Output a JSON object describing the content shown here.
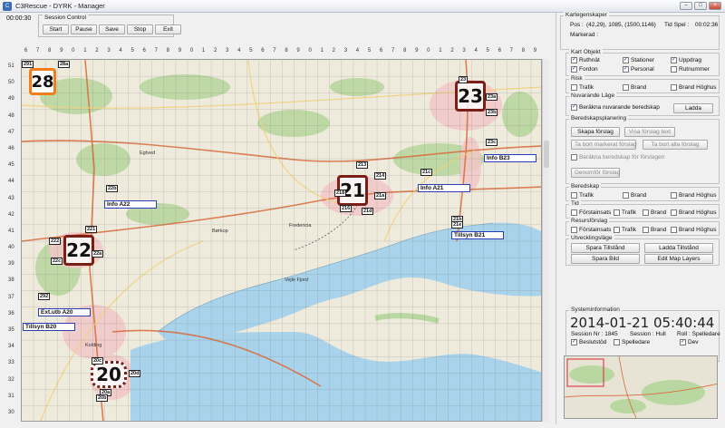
{
  "window": {
    "title": "C3Rescue - DYRK - Manager",
    "icon_name": "app-icon",
    "buttons": [
      "minimize-icon",
      "maximize-icon",
      "close-icon"
    ]
  },
  "clock": "00:00:30",
  "session_control": {
    "legend": "Session Control",
    "buttons": [
      "Start",
      "Pause",
      "Save",
      "Stop",
      "Exit"
    ]
  },
  "grid": {
    "columns": [
      "6",
      "7",
      "8",
      "9",
      "0",
      "1",
      "2",
      "3",
      "4",
      "5",
      "6",
      "7",
      "8",
      "9",
      "0",
      "1",
      "2",
      "3",
      "4",
      "5",
      "6",
      "7",
      "8",
      "9",
      "0",
      "1",
      "2",
      "3",
      "4",
      "5",
      "6",
      "7",
      "8",
      "9",
      "0",
      "1",
      "2",
      "3",
      "4",
      "5",
      "6",
      "7",
      "8",
      "9"
    ],
    "rows": [
      "51",
      "50",
      "49",
      "48",
      "47",
      "46",
      "45",
      "44",
      "43",
      "42",
      "41",
      "40",
      "39",
      "38",
      "37",
      "36",
      "35",
      "34",
      "33",
      "32",
      "31",
      "30"
    ]
  },
  "map": {
    "units": [
      {
        "label": "28",
        "style": "orange"
      },
      {
        "label": "23",
        "style": "dark"
      },
      {
        "label": "21",
        "style": "dark"
      },
      {
        "label": "22",
        "style": "dark"
      },
      {
        "label": "20",
        "style": "dotted"
      }
    ],
    "tags": [
      "291",
      "28a",
      "23",
      "23a",
      "23b",
      "23c",
      "21c",
      "213",
      "214",
      "21a",
      "21b",
      "21e",
      "218",
      "216",
      "21d",
      "22b",
      "22a",
      "22c",
      "221",
      "222",
      "292",
      "20c",
      "20a",
      "20b",
      "20d"
    ],
    "info_boxes": [
      "Info A22",
      "Info B23",
      "Info A21",
      "Tillsyn B21",
      "Ext.utb A20",
      "Tillsyn B20"
    ],
    "places": [
      "Vejle Fjord",
      "Kolding",
      "Fredericia",
      "Børkop",
      "Egtved"
    ]
  },
  "panel": {
    "kartegenskaper": {
      "legend": "Kartegenskaper",
      "pos_label": "Pos :",
      "pos_value": "(42,29), 1085, (1500,1146)",
      "tid_spel_label": "Tid Spel :",
      "tid_spel_value": "00:02:36",
      "markerad_label": "Markerad :"
    },
    "kart_objekt": {
      "legend": "Kart Objekt",
      "items": [
        {
          "label": "Ruthnät",
          "checked": true
        },
        {
          "label": "Stationer",
          "checked": true
        },
        {
          "label": "Uppdrag",
          "checked": true
        },
        {
          "label": "Fordon",
          "checked": true
        },
        {
          "label": "Personal",
          "checked": true
        },
        {
          "label": "Rutnummer",
          "checked": false
        }
      ]
    },
    "risk": {
      "legend": "Risk",
      "items": [
        {
          "label": "Trafik"
        },
        {
          "label": "Brand"
        },
        {
          "label": "Brand Höghus"
        }
      ]
    },
    "nuvarande": {
      "legend": "Nuvarande Läge",
      "checkbox_label": "Beräkna nuvarande beredskap",
      "button": "Ladda"
    },
    "beredskapsplanering": {
      "legend": "Beredskapsplanering",
      "skapa": "Skapa förslag",
      "visa": "Visa förslag text",
      "ta_bort_markerat": "Ta bort markerat förslag",
      "ta_bort_alla": "Ta bort alla förslag",
      "berakna_label": "Beräkna beredskap för förslagen",
      "genomfor": "Genomför förslag"
    },
    "beredskap": {
      "legend": "Beredskap",
      "items": [
        {
          "label": "Trafik"
        },
        {
          "label": "Brand"
        },
        {
          "label": "Brand Höghus"
        }
      ]
    },
    "tid": {
      "legend": "Tid",
      "items": [
        {
          "label": "Förstainsats"
        },
        {
          "label": "Trafik"
        },
        {
          "label": "Brand"
        },
        {
          "label": "Brand Höghus"
        }
      ]
    },
    "resursforslag": {
      "legend": "Resursförslag",
      "items": [
        {
          "label": "Förstainsats"
        },
        {
          "label": "Trafik"
        },
        {
          "label": "Brand"
        },
        {
          "label": "Brand Höghus"
        }
      ]
    },
    "utvecklingslage": {
      "legend": "Utvecklingsläge",
      "spara_tillstand": "Spara Tillstånd",
      "ladda_tillstand": "Ladda Tillstånd",
      "spara_bild": "Spara Bild",
      "edit_map_layers": "Edit Map Layers"
    },
    "systeminformation": {
      "legend": "Systeminformation",
      "datetime": "2014-01-21  05:40:44",
      "session_nr": "Session Nr : 1845",
      "session": "Session : Hull",
      "roll": "Roll : Spelledare",
      "beslutstod": "Beslutstöd",
      "spelledare": "Spelledare",
      "dev": "Dev"
    }
  }
}
